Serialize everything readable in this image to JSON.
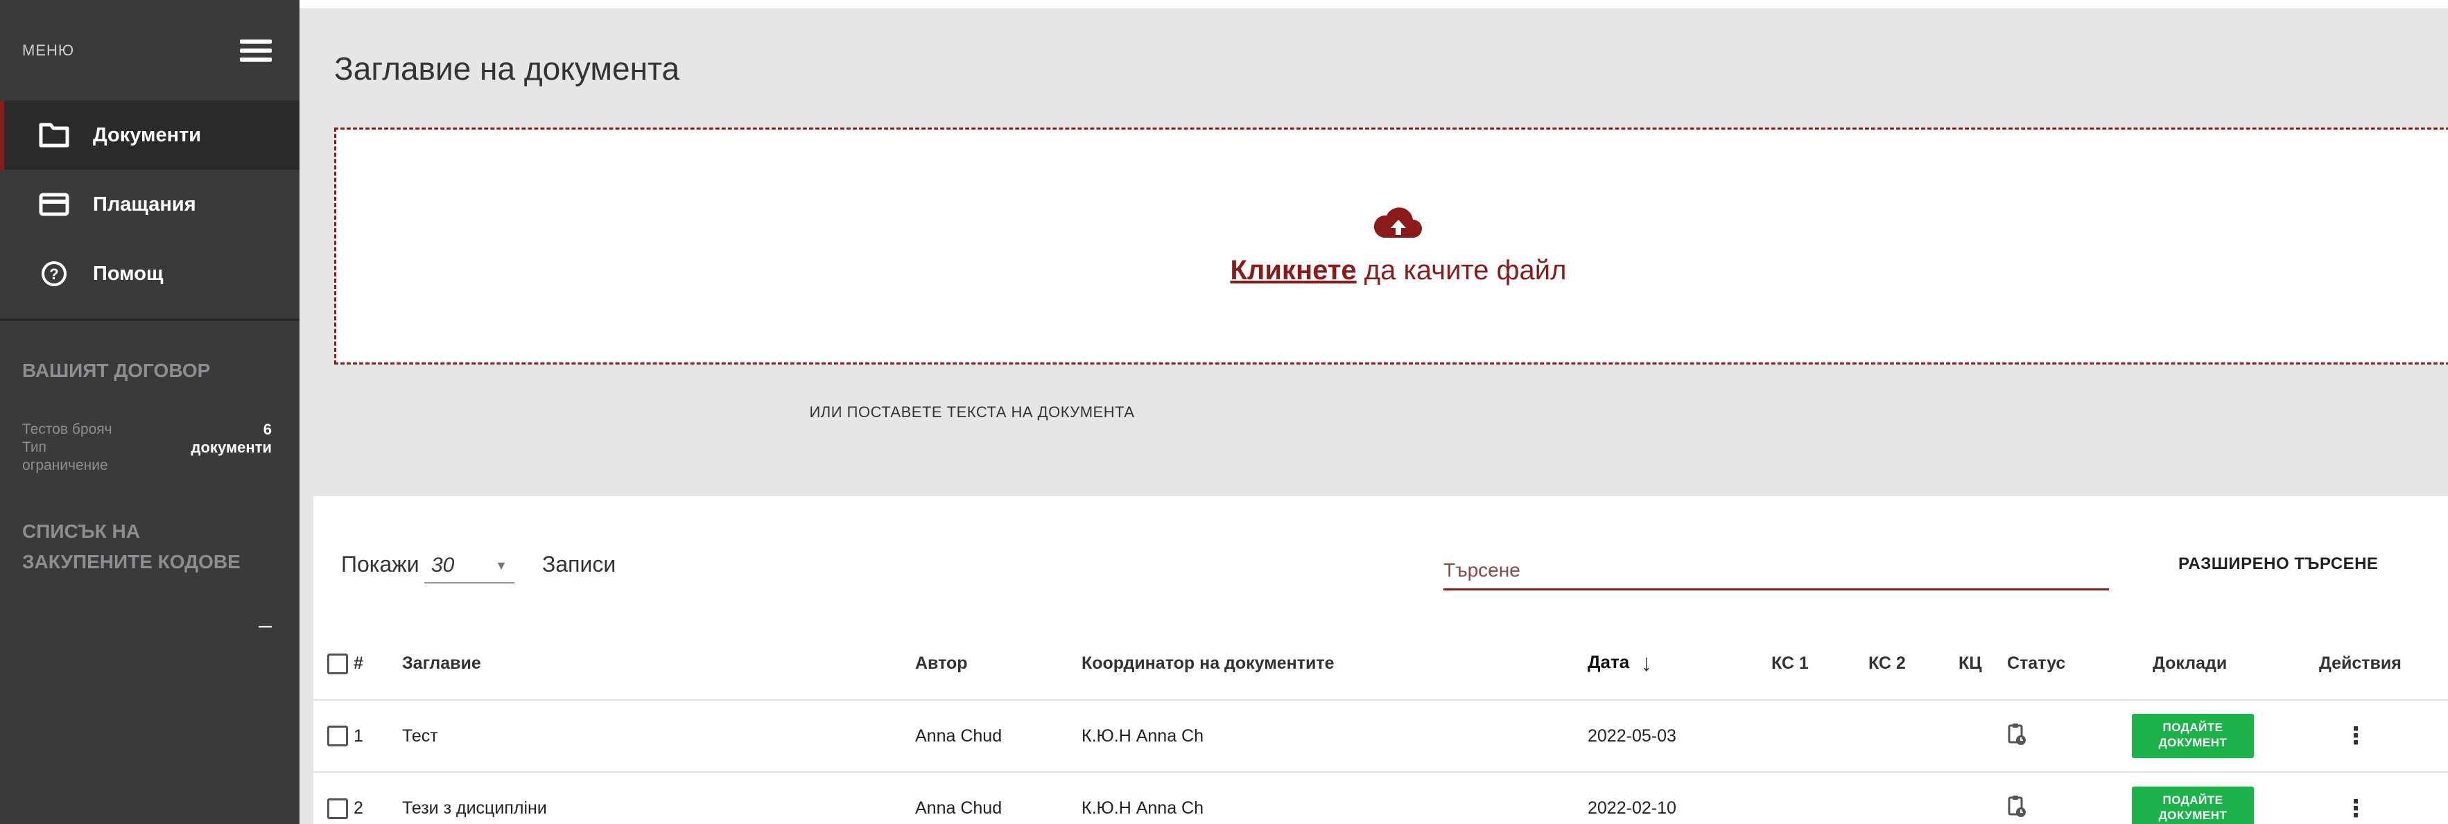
{
  "sidebar": {
    "menu_label": "МЕНЮ",
    "items": [
      {
        "label": "Документи",
        "icon": "folder-icon",
        "active": true
      },
      {
        "label": "Плащания",
        "icon": "credit-card-icon",
        "active": false
      },
      {
        "label": "Помощ",
        "icon": "help-circle-icon",
        "active": false
      }
    ],
    "contract": {
      "title": "ВАШИЯТ ДОГОВОР",
      "tests_label": "Тестов брояч",
      "tests_value": "6",
      "type_label_1": "Тип",
      "type_label_2": "ограничение",
      "type_value": "документи"
    },
    "codes": {
      "title_1": "СПИСЪК НА",
      "title_2": "ЗАКУПЕНИТЕ КОДОВЕ",
      "value": "–"
    }
  },
  "main": {
    "doc_title": "Заглавие на документа",
    "upload": {
      "link": "Кликнете",
      "text": " да качите файл"
    },
    "paste_link": "ИЛИ ПОСТАВЕТЕ ТЕКСТА НА ДОКУМЕНТА"
  },
  "table": {
    "show_label": "Покажи",
    "page_size": "30",
    "records_label": "Записи",
    "search_placeholder": "Търсене",
    "advanced_search": "РАЗШИРЕНО ТЪРСЕНЕ",
    "columns": {
      "num": "#",
      "title": "Заглавие",
      "author": "Автор",
      "coordinator": "Координатор на документите",
      "date": "Дата",
      "ks1": "КС 1",
      "ks2": "КС 2",
      "kc": "КЦ",
      "status": "Статус",
      "reports": "Доклади",
      "actions": "Действия"
    },
    "rows": [
      {
        "num": "1",
        "title": "Тест",
        "author": "Anna Chud",
        "coordinator": "К.Ю.Н Anna Ch",
        "date": "2022-05-03",
        "button_1": "ПОДАЙТЕ",
        "button_2": "ДОКУМЕНТ"
      },
      {
        "num": "2",
        "title": "Тези з дисциплiни",
        "author": "Anna Chud",
        "coordinator": "К.Ю.Н Anna Ch",
        "date": "2022-02-10",
        "button_1": "ПОДАЙТЕ",
        "button_2": "ДОКУМЕНТ"
      }
    ]
  },
  "colors": {
    "accent": "#8b1a1a",
    "sidebar_bg": "#3a3a3c",
    "submit_green": "#1cb34a"
  }
}
